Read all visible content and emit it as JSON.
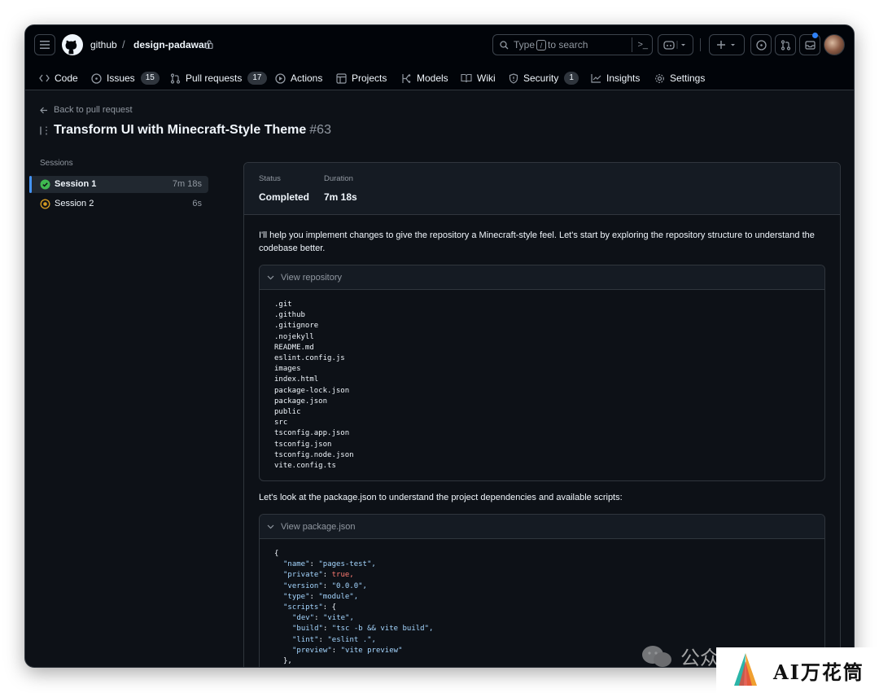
{
  "header": {
    "owner": "github",
    "separator": "/",
    "repo": "design-padawan",
    "search_prefix": "Type",
    "search_key": "/",
    "search_suffix": "to search",
    "search_cmd": ">_"
  },
  "nav": {
    "items": [
      {
        "label": "Code",
        "icon": "code-icon"
      },
      {
        "label": "Issues",
        "icon": "issue-icon",
        "count": "15"
      },
      {
        "label": "Pull requests",
        "icon": "pull-request-icon",
        "count": "17"
      },
      {
        "label": "Actions",
        "icon": "play-icon"
      },
      {
        "label": "Projects",
        "icon": "table-icon"
      },
      {
        "label": "Models",
        "icon": "model-icon"
      },
      {
        "label": "Wiki",
        "icon": "book-icon"
      },
      {
        "label": "Security",
        "icon": "shield-icon",
        "count": "1"
      },
      {
        "label": "Insights",
        "icon": "graph-icon"
      },
      {
        "label": "Settings",
        "icon": "gear-icon"
      }
    ]
  },
  "page": {
    "back_label": "Back to pull request",
    "title": "Transform UI with Minecraft-Style Theme",
    "number": "#63"
  },
  "sessions": {
    "label": "Sessions",
    "items": [
      {
        "name": "Session 1",
        "duration": "7m 18s",
        "status": "completed"
      },
      {
        "name": "Session 2",
        "duration": "6s",
        "status": "in-progress"
      }
    ]
  },
  "status": {
    "status_label": "Status",
    "status_value": "Completed",
    "duration_label": "Duration",
    "duration_value": "7m 18s"
  },
  "log": {
    "intro": "I'll help you implement changes to give the repository a Minecraft-style feel. Let's start by exploring the repository structure to understand the codebase better.",
    "tool1_label": "View repository",
    "tool1_output": ".git\n.github\n.gitignore\n.nojekyll\nREADME.md\neslint.config.js\nimages\nindex.html\npackage-lock.json\npackage.json\npublic\nsrc\ntsconfig.app.json\ntsconfig.json\ntsconfig.node.json\nvite.config.ts",
    "second": "Let's look at the package.json to understand the project dependencies and available scripts:",
    "tool2_label": "View package.json",
    "json_lines": [
      {
        "k": "",
        "v": "{",
        "t": "plain",
        "indent": 0
      },
      {
        "k": "\"name\"",
        "v": "\"pages-test\",",
        "t": "str",
        "indent": 1
      },
      {
        "k": "\"private\"",
        "v": "true,",
        "t": "bool",
        "indent": 1
      },
      {
        "k": "\"version\"",
        "v": "\"0.0.0\",",
        "t": "str",
        "indent": 1
      },
      {
        "k": "\"type\"",
        "v": "\"module\",",
        "t": "str",
        "indent": 1
      },
      {
        "k": "\"scripts\"",
        "v": "{",
        "t": "plain",
        "indent": 1
      },
      {
        "k": "\"dev\"",
        "v": "\"vite\",",
        "t": "str",
        "indent": 2
      },
      {
        "k": "\"build\"",
        "v": "\"tsc -b && vite build\",",
        "t": "str",
        "indent": 2
      },
      {
        "k": "\"lint\"",
        "v": "\"eslint .\",",
        "t": "str",
        "indent": 2
      },
      {
        "k": "\"preview\"",
        "v": "\"vite preview\"",
        "t": "str",
        "indent": 2
      },
      {
        "k": "",
        "v": "},",
        "t": "plain",
        "indent": 1
      }
    ]
  },
  "watermark": {
    "text": "公众",
    "brand": "AI万花筒"
  },
  "colors": {
    "success": "#3fb950",
    "pending": "#d29922",
    "accent": "#4493f8"
  }
}
